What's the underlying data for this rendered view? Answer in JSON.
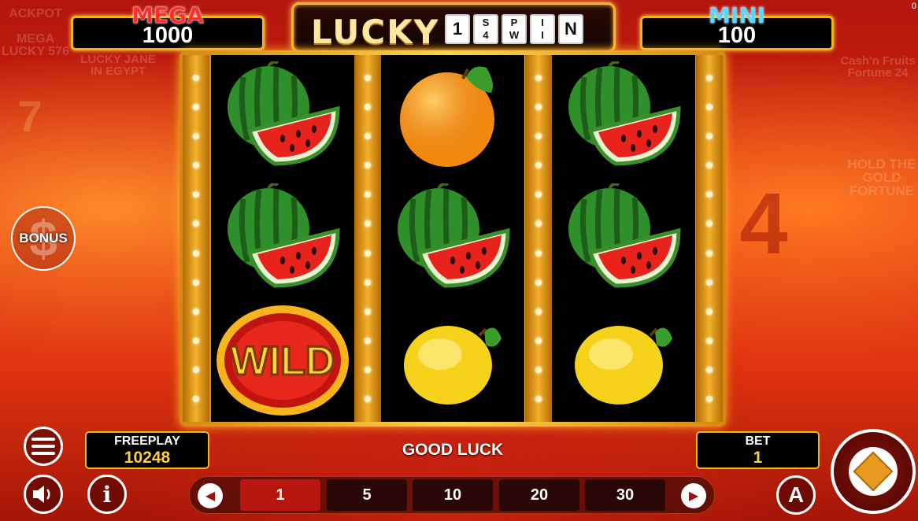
{
  "jackpots": {
    "mega": {
      "label": "MEGA",
      "value": "1000"
    },
    "mini": {
      "label": "MINI",
      "value": "100"
    }
  },
  "logo": {
    "word": "LUCKY",
    "tiles": [
      "1",
      "S|4",
      "P|W",
      "I|I",
      "N"
    ]
  },
  "reels": [
    [
      "watermelon",
      "watermelon",
      "wild"
    ],
    [
      "orange",
      "watermelon",
      "lemon"
    ],
    [
      "watermelon",
      "watermelon",
      "lemon"
    ]
  ],
  "wild_label": "WILD",
  "freeplay": {
    "label": "FREEPLAY",
    "value": "10248"
  },
  "message": "GOOD LUCK",
  "bet": {
    "label": "BET",
    "value": "1"
  },
  "bet_options": [
    "1",
    "5",
    "10",
    "20",
    "30"
  ],
  "selected_bet": "1",
  "bonus_label": "BONUS",
  "auto_label": "A",
  "corner_value": "0",
  "icons": {
    "menu": "hamburger-icon",
    "sound": "speaker-icon",
    "info": "info-icon",
    "prev": "chevron-left-icon",
    "next": "chevron-right-icon",
    "auto": "autoplay-icon",
    "spin": "spin-icon"
  }
}
